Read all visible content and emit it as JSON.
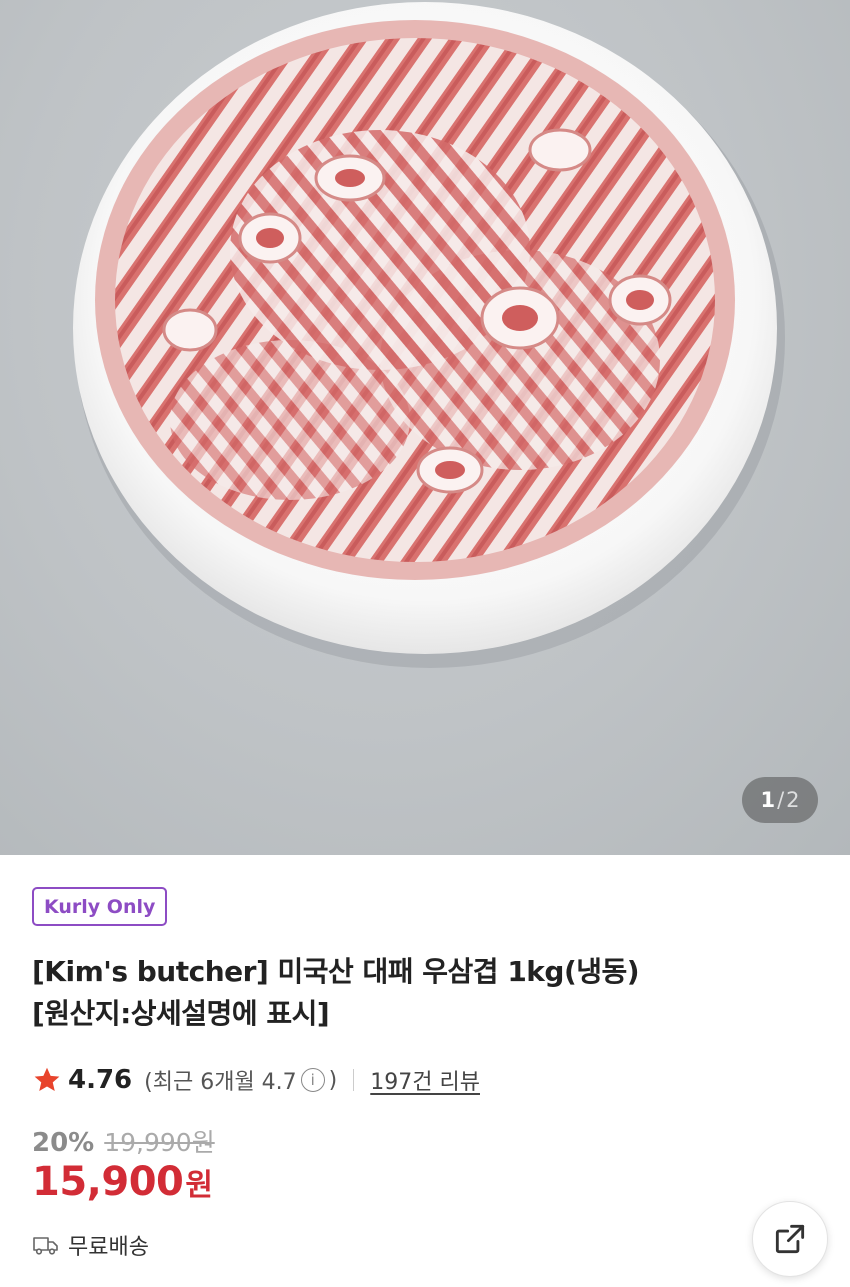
{
  "hero": {
    "image_alt": "product-photo",
    "pager": {
      "current": "1",
      "separator": "/",
      "total": "2"
    }
  },
  "badge": {
    "label": "Kurly Only",
    "color": "#8d4cc4"
  },
  "title": {
    "line1": "[Kim's butcher] 미국산 대패 우삼겹 1kg(냉동)",
    "line2": "[원산지:상세설명에 표시]"
  },
  "rating": {
    "score": "4.76",
    "recent_open": "(최근 6개월 4.7",
    "info_glyph": "i",
    "recent_close": ")",
    "reviews": "197건 리뷰",
    "star_color": "#e8442c"
  },
  "price": {
    "discount": "20%",
    "original": "19,990원",
    "sale": "15,900",
    "currency": "원",
    "color": "#d22c36"
  },
  "shipping": {
    "label": "무료배송",
    "icon": "truck-icon"
  },
  "share": {
    "icon": "share-icon"
  }
}
